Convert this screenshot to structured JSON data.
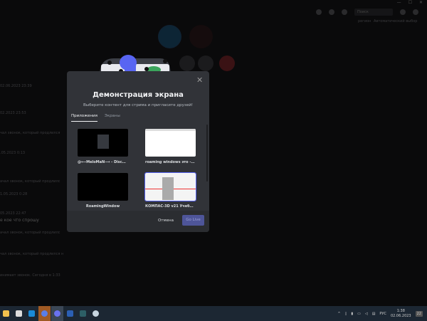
{
  "background": {
    "search_placeholder": "Поиск",
    "region_label": "регион",
    "region_value": "Автоматический выбор",
    "chat_lines": [
      "02.06.2023 23:39",
      "02.2023 23:53",
      "чал звонок, который продлился",
      ".05.2023 0:13",
      "ачал звонок, который продлилс",
      "1.05.2023 0:28",
      "05.2023 22:47",
      "е кое что спрошу",
      "ачал звонок, который продлилс",
      "чал звонок, который продлился н",
      "инимает звонок. Сегодня в 1:33"
    ]
  },
  "modal": {
    "title": "Демонстрация экрана",
    "subtitle": "Выберите контент для стрима и пригласите друзей!",
    "tabs": [
      {
        "label": "Приложения",
        "active": true
      },
      {
        "label": "Экраны",
        "active": false
      }
    ],
    "windows": [
      {
        "label": "@⟵MeloMaN⟶ - Discord",
        "selected": false
      },
      {
        "label": "roaming windows это - Go...",
        "selected": false
      },
      {
        "label": "RoamingWindow",
        "selected": false
      },
      {
        "label": "КОМПАС-3D v21 Учебная ...",
        "selected": true
      }
    ],
    "cancel_label": "Отмена",
    "go_live_label": "Go Live",
    "accent": "#5865f2"
  },
  "taskbar": {
    "apps": [
      "file-explorer",
      "store",
      "mail",
      "discord-ptb",
      "discord",
      "word",
      "kompas",
      "steam"
    ],
    "language": "РУС",
    "time": "1:38",
    "date": "02.06.2023",
    "notifications": "22"
  }
}
